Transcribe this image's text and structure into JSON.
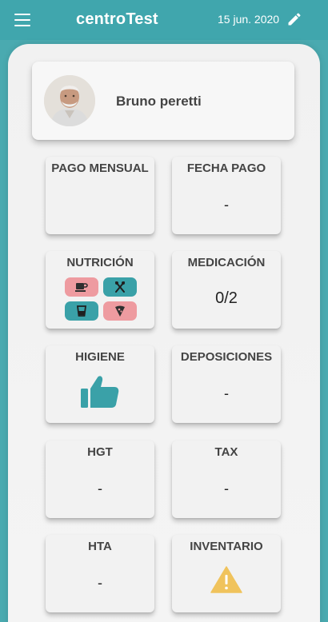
{
  "app": {
    "title": "centroTest",
    "date": "15 jun. 2020"
  },
  "profile": {
    "name": "Bruno peretti"
  },
  "tiles": {
    "pago_mensual": {
      "title": "PAGO MENSUAL",
      "value": ""
    },
    "fecha_pago": {
      "title": "FECHA PAGO",
      "value": "-"
    },
    "nutricion": {
      "title": "NUTRICIÓN",
      "items": [
        "coffee-icon",
        "cutlery-icon",
        "cup-icon",
        "pizza-icon"
      ]
    },
    "medicacion": {
      "title": "MEDICACIÓN",
      "value": "0/2"
    },
    "higiene": {
      "title": "HIGIENE",
      "icon": "thumbs-up-icon"
    },
    "deposiciones": {
      "title": "DEPOSICIONES",
      "value": "-"
    },
    "hgt": {
      "title": "HGT",
      "value": "-"
    },
    "tax": {
      "title": "TAX",
      "value": "-"
    },
    "hta": {
      "title": "HTA",
      "value": "-"
    },
    "inventario": {
      "title": "INVENTARIO",
      "icon": "warning-icon"
    }
  },
  "colors": {
    "appbar": "#40a6ad",
    "teal": "#3aa1a8",
    "pink": "#ee9ba0",
    "warning": "#f0c35c"
  }
}
